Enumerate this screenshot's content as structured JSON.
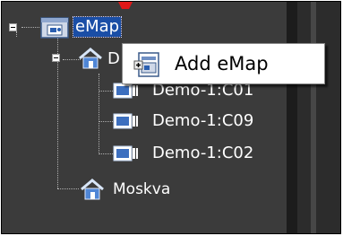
{
  "tree": {
    "root": {
      "label": "eMap",
      "icon": "emap-folder-icon",
      "expanded": true,
      "selected": true
    },
    "children": [
      {
        "label": "D",
        "icon": "site-icon",
        "expanded": true
      },
      {
        "label": "Demo-1:C01",
        "icon": "camera-icon"
      },
      {
        "label": "Demo-1:C09",
        "icon": "camera-icon"
      },
      {
        "label": "Demo-1:C02",
        "icon": "camera-icon"
      },
      {
        "label": "Moskva",
        "icon": "site-icon"
      }
    ]
  },
  "context_menu": {
    "items": [
      {
        "label": "Add eMap",
        "icon": "add-emap-icon"
      }
    ]
  },
  "colors": {
    "tree_background": "#3b3b3b",
    "selection": "#1a4ea6",
    "text": "#ffffff",
    "menu_background": "#ffffff"
  }
}
